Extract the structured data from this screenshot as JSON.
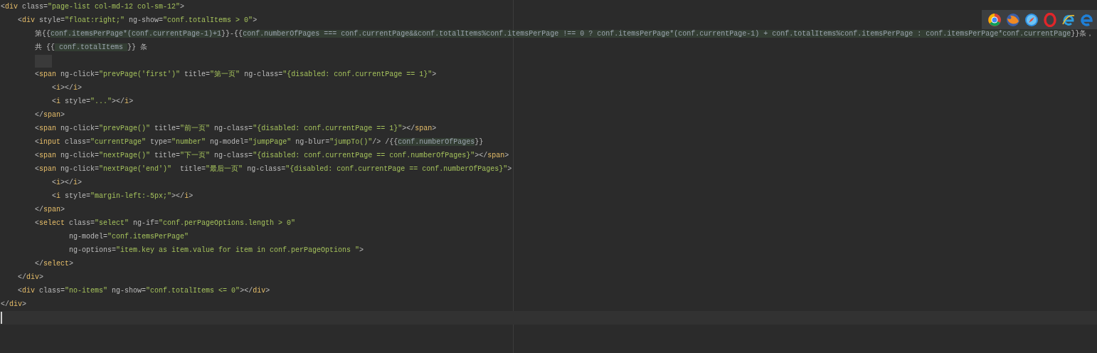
{
  "editor": {
    "lines": [
      {
        "kind": "code",
        "text": "<div class=\"page-list col-md-12 col-sm-12\">"
      },
      {
        "kind": "code",
        "text": "    <div style=\"float:right;\" ng-show=\"conf.totalItems > 0\">"
      },
      {
        "kind": "code",
        "text": "        第{{conf.itemsPerPage*(conf.currentPage-1)+1}}-{{conf.numberOfPages === conf.currentPage&&conf.totalItems%conf.itemsPerPage !== 0 ? conf.itemsPerPage*(conf.currentPage-1) + conf.totalItems%conf.itemsPerPage : conf.itemsPerPage*conf.currentPage}}条，"
      },
      {
        "kind": "code",
        "text": "        共 {{ conf.totalItems }} 条"
      },
      {
        "kind": "whitespace"
      },
      {
        "kind": "code",
        "text": "        <span ng-click=\"prevPage('first')\" title=\"第一页\" ng-class=\"{disabled: conf.currentPage == 1}\">"
      },
      {
        "kind": "code",
        "text": "            <i></i>"
      },
      {
        "kind": "code",
        "text": "            <i style=\"...\"></i>"
      },
      {
        "kind": "code",
        "text": "        </span>"
      },
      {
        "kind": "code",
        "text": "        <span ng-click=\"prevPage()\" title=\"前一页\" ng-class=\"{disabled: conf.currentPage == 1}\"></span>"
      },
      {
        "kind": "code",
        "text": "        <input class=\"currentPage\" type=\"number\" ng-model=\"jumpPage\" ng-blur=\"jumpTo()\"/> /{{conf.numberOfPages}}"
      },
      {
        "kind": "code",
        "text": "        <span ng-click=\"nextPage()\" title=\"下一页\" ng-class=\"{disabled: conf.currentPage == conf.numberOfPages}\"></span>"
      },
      {
        "kind": "code",
        "text": "        <span ng-click=\"nextPage('end')\"  title=\"最后一页\" ng-class=\"{disabled: conf.currentPage == conf.numberOfPages}\">"
      },
      {
        "kind": "code",
        "text": "            <i></i>"
      },
      {
        "kind": "code",
        "text": "            <i style=\"margin-left:-5px;\"></i>"
      },
      {
        "kind": "code",
        "text": "        </span>"
      },
      {
        "kind": "code",
        "text": "        <select class=\"select\" ng-if=\"conf.perPageOptions.length > 0\""
      },
      {
        "kind": "code",
        "text": "                ng-model=\"conf.itemsPerPage\""
      },
      {
        "kind": "code",
        "text": "                ng-options=\"item.key as item.value for item in conf.perPageOptions \">"
      },
      {
        "kind": "code",
        "text": "        </select>"
      },
      {
        "kind": "code",
        "text": "    </div>"
      },
      {
        "kind": "code",
        "text": "    <div class=\"no-items\" ng-show=\"conf.totalItems <= 0\"></div>"
      },
      {
        "kind": "code",
        "text": "</div>"
      },
      {
        "kind": "cursor"
      }
    ]
  },
  "browser_toolbar": {
    "icons": [
      {
        "kind": "wheel"
      },
      {
        "kind": "globe"
      },
      {
        "kind": "compass"
      },
      {
        "kind": "ring"
      },
      {
        "kind": "swirl"
      },
      {
        "kind": "swirl2"
      }
    ]
  }
}
